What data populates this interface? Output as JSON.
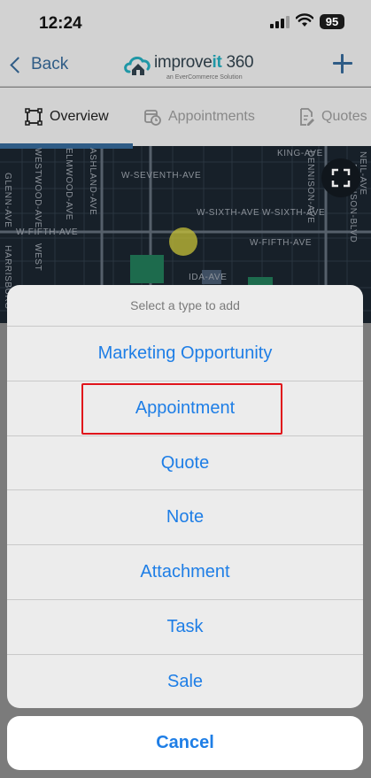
{
  "status_bar": {
    "time": "12:24",
    "battery": "95"
  },
  "nav": {
    "back_label": "Back",
    "logo_prefix": "improve",
    "logo_it": "it",
    "logo_suffix": " 360",
    "logo_subtitle": "an EverCommerce Solution"
  },
  "tabs": [
    {
      "label": "Overview",
      "icon": "overview-icon",
      "active": true
    },
    {
      "label": "Appointments",
      "icon": "calendar-clock-icon",
      "active": false
    },
    {
      "label": "Quotes",
      "icon": "document-edit-icon",
      "active": false
    }
  ],
  "map": {
    "streets": {
      "king_ave": "KING-AVE",
      "w_seventh_ave": "W-SEVENTH-AVE",
      "w_sixth_ave_1": "W-SIXTH-AVE",
      "w_sixth_ave_2": "W-SIXTH-AVE",
      "w_fifth_ave_1": "W-FIFTH-AVE",
      "w_fifth_ave_2": "W-FIFTH-AVE",
      "ida_ave": "IDA-AVE",
      "westwood_ave": "WESTWOOD-AVE",
      "elmwood_ave": "ELMWOOD-AVE",
      "ashland_ave": "ASHLAND-AVE",
      "glenn_ave": "GLENN-AVE",
      "west": "WEST",
      "harrisburg": "HARRISBURG",
      "dennison_ave": "DENNISON-AVE",
      "neil_ave": "NEIL-AVE",
      "dennison_blvd": "DENNISON-BLVD"
    }
  },
  "action_sheet": {
    "title": "Select a type to add",
    "options": [
      "Marketing Opportunity",
      "Appointment",
      "Quote",
      "Note",
      "Attachment",
      "Task",
      "Sale"
    ],
    "cancel_label": "Cancel"
  },
  "colors": {
    "accent": "#1e7ee6",
    "brand": "#2f5c86",
    "highlight": "#e0141b"
  }
}
